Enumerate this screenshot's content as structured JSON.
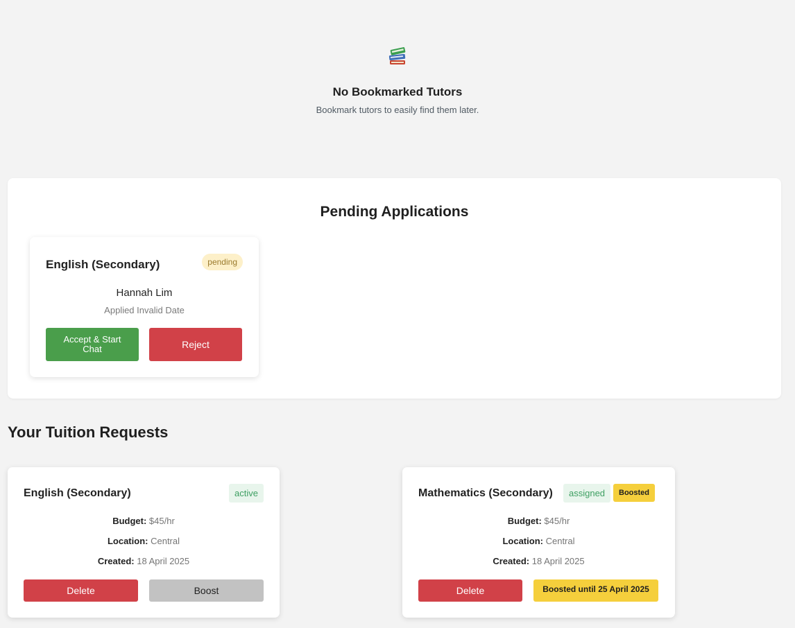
{
  "empty_state": {
    "icon": "books-icon",
    "title": "No Bookmarked Tutors",
    "subtitle": "Bookmark tutors to easily find them later."
  },
  "pending": {
    "title": "Pending Applications",
    "applications": [
      {
        "subject": "English (Secondary)",
        "status": "pending",
        "tutor_name": "Hannah Lim",
        "applied": "Applied Invalid Date",
        "accept_label": "Accept & Start Chat",
        "reject_label": "Reject"
      }
    ]
  },
  "requests": {
    "title": "Your Tuition Requests",
    "items": [
      {
        "subject": "English (Secondary)",
        "status": "active",
        "budget_label": "Budget:",
        "budget": "$45/hr",
        "location_label": "Location:",
        "location": "Central",
        "created_label": "Created:",
        "created": "18 April 2025",
        "delete_label": "Delete",
        "boost_label": "Boost"
      },
      {
        "subject": "Mathematics (Secondary)",
        "status": "assigned",
        "boosted_badge": "Boosted",
        "budget_label": "Budget:",
        "budget": "$45/hr",
        "location_label": "Location:",
        "location": "Central",
        "created_label": "Created:",
        "created": "18 April 2025",
        "delete_label": "Delete",
        "boosted_until": "Boosted until 25 April 2025"
      }
    ]
  },
  "colors": {
    "accept": "#4a9e4b",
    "reject": "#d14148",
    "boosted": "#f5cf3c",
    "active_bg": "#e8f5ec",
    "active_text": "#3e9f62",
    "pending_bg": "#fdf0c9"
  }
}
